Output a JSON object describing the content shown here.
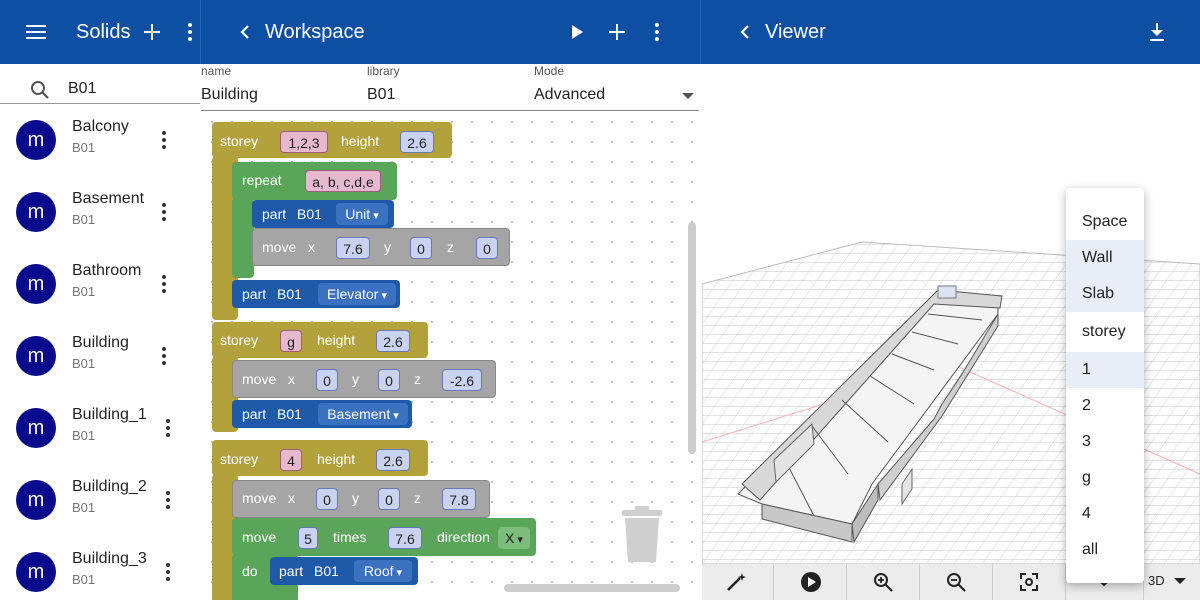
{
  "solids": {
    "title": "Solids",
    "search_value": "B01",
    "items": [
      {
        "avatar": "m",
        "name": "Balcony",
        "library": "B01"
      },
      {
        "avatar": "m",
        "name": "Basement",
        "library": "B01"
      },
      {
        "avatar": "m",
        "name": "Bathroom",
        "library": "B01"
      },
      {
        "avatar": "m",
        "name": "Building",
        "library": "B01"
      },
      {
        "avatar": "m",
        "name": "Building_1",
        "library": "B01"
      },
      {
        "avatar": "m",
        "name": "Building_2",
        "library": "B01"
      },
      {
        "avatar": "m",
        "name": "Building_3",
        "library": "B01"
      }
    ]
  },
  "workspace": {
    "title": "Workspace",
    "fields": {
      "name_label": "name",
      "name_value": "Building",
      "library_label": "library",
      "library_value": "B01",
      "mode_label": "Mode",
      "mode_value": "Advanced"
    },
    "blocks": {
      "storey_kw": "storey",
      "height_kw": "height",
      "repeat_kw": "repeat",
      "part_kw": "part",
      "move_kw": "move",
      "x_kw": "x",
      "y_kw": "y",
      "z_kw": "z",
      "times_kw": "times",
      "direction_kw": "direction",
      "do_kw": "do",
      "s1_storeys": "1,2,3",
      "s1_height": "2.6",
      "repeat_list": "a, b, c,d,e",
      "part1_lib": "B01",
      "part1_name": "Unit",
      "move1_x": "7.6",
      "move1_y": "0",
      "move1_z": "0",
      "part2_lib": "B01",
      "part2_name": "Elevator",
      "s2_storeys": "g",
      "s2_height": "2.6",
      "move2_x": "0",
      "move2_y": "0",
      "move2_z": "-2.6",
      "part3_lib": "B01",
      "part3_name": "Basement",
      "s3_storeys": "4",
      "s3_height": "2.6",
      "move3_x": "0",
      "move3_y": "0",
      "move3_z": "7.8",
      "loop_times": "5",
      "loop_step": "7.6",
      "loop_dir": "X",
      "part4_lib": "B01",
      "part4_name": "Roof"
    }
  },
  "viewer": {
    "title": "Viewer",
    "menu": [
      "Space",
      "Wall",
      "Slab",
      "storey",
      "1",
      "2",
      "3",
      "g",
      "4",
      "all"
    ],
    "menu_selected": [
      "Wall",
      "Slab",
      "1"
    ],
    "view_mode": "3D",
    "toolbar_icons": [
      "magic-wand-icon",
      "play-circle-icon",
      "zoom-in-icon",
      "zoom-out-icon",
      "fit-screen-icon",
      "chevron-down-icon"
    ]
  },
  "colors": {
    "appbar": "#0d4fa3",
    "avatar": "#0a0a8c",
    "storey_block": "#b3a23c",
    "loop_block": "#5ba55a",
    "part_block": "#1e5aa8",
    "move_block": "#a5a5a5"
  }
}
